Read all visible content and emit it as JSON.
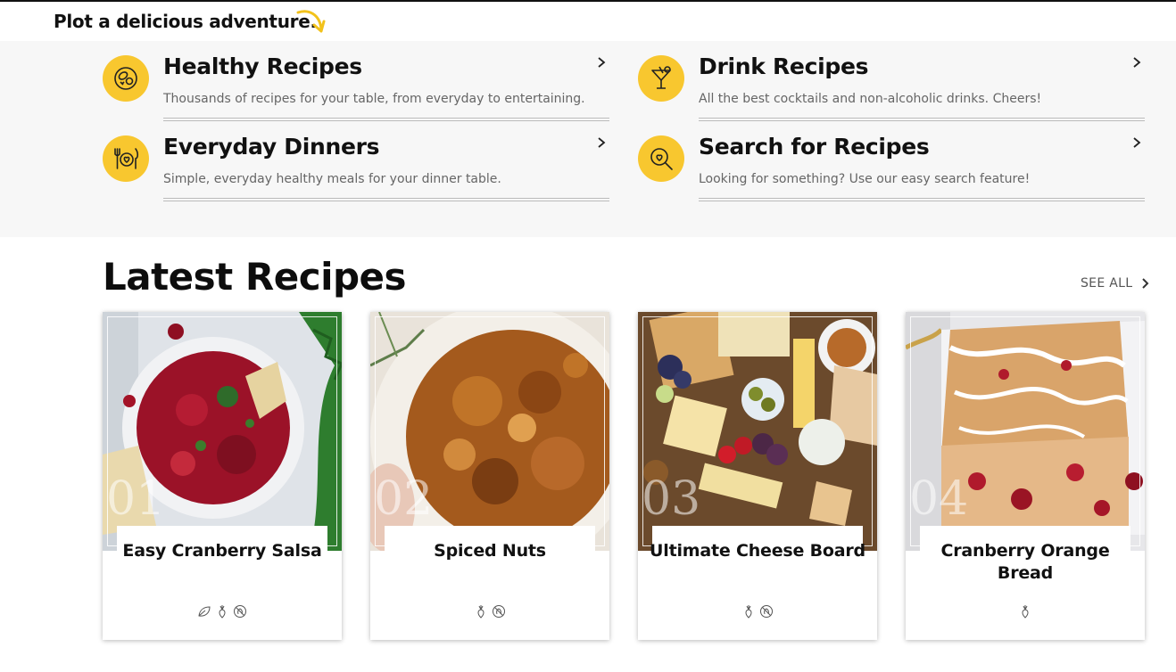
{
  "header": {
    "tagline": "Plot a delicious adventure."
  },
  "categories": [
    {
      "title": "Healthy Recipes",
      "desc": "Thousands of recipes for your table, from everyday to entertaining.",
      "icon": "healthy-food-icon"
    },
    {
      "title": "Drink Recipes",
      "desc": "All the best cocktails and non-alcoholic drinks. Cheers!",
      "icon": "cocktail-icon"
    },
    {
      "title": "Everyday Dinners",
      "desc": "Simple, everyday healthy meals for your dinner table.",
      "icon": "dinner-plate-icon"
    },
    {
      "title": "Search for Recipes",
      "desc": "Looking for something? Use our easy search feature!",
      "icon": "search-heart-icon"
    }
  ],
  "latest": {
    "title": "Latest Recipes",
    "see_all": "SEE ALL",
    "cards": [
      {
        "num": "01",
        "title": "Easy Cranberry Salsa",
        "tags": [
          "vegan-icon",
          "vegetarian-icon",
          "gluten-free-icon"
        ]
      },
      {
        "num": "02",
        "title": "Spiced Nuts",
        "tags": [
          "vegetarian-icon",
          "gluten-free-icon"
        ]
      },
      {
        "num": "03",
        "title": "Ultimate Cheese Board",
        "tags": [
          "vegetarian-icon",
          "gluten-free-icon"
        ]
      },
      {
        "num": "04",
        "title": "Cranberry Orange Bread",
        "tags": [
          "vegetarian-icon"
        ]
      }
    ]
  },
  "colors": {
    "accent": "#f8c72f",
    "section_bg": "#f7f7f7"
  }
}
